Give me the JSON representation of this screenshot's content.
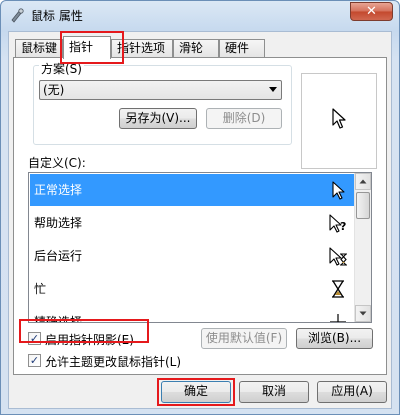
{
  "window": {
    "title": "鼠标 属性",
    "close_label": "✕"
  },
  "tabs": [
    {
      "label": "鼠标键"
    },
    {
      "label": "指针",
      "active": true
    },
    {
      "label": "指针选项"
    },
    {
      "label": "滑轮"
    },
    {
      "label": "硬件"
    }
  ],
  "scheme": {
    "label": "方案(S)",
    "value": "(无)",
    "save_as_label": "另存为(V)...",
    "delete_label": "删除(D)"
  },
  "customize": {
    "label": "自定义(C):",
    "items": [
      {
        "label": "正常选择",
        "icon": "arrow-cursor-icon",
        "selected": true
      },
      {
        "label": "帮助选择",
        "icon": "help-cursor-icon"
      },
      {
        "label": "后台运行",
        "icon": "working-in-background-cursor-icon"
      },
      {
        "label": "忙",
        "icon": "busy-hourglass-cursor-icon"
      },
      {
        "label": "精确选择",
        "icon": "precision-cursor-icon"
      }
    ]
  },
  "options": {
    "pointer_shadow": {
      "label": "启用指针阴影(E)",
      "checked": true
    },
    "allow_themes": {
      "label": "允许主题更改鼠标指针(L)",
      "checked": true
    },
    "use_default_label": "使用默认值(F)",
    "browse_label": "浏览(B)..."
  },
  "footer": {
    "ok_label": "确定",
    "cancel_label": "取消",
    "apply_label": "应用(A)"
  },
  "colors": {
    "selection": "#3399ff",
    "highlight": "#e5191c"
  }
}
